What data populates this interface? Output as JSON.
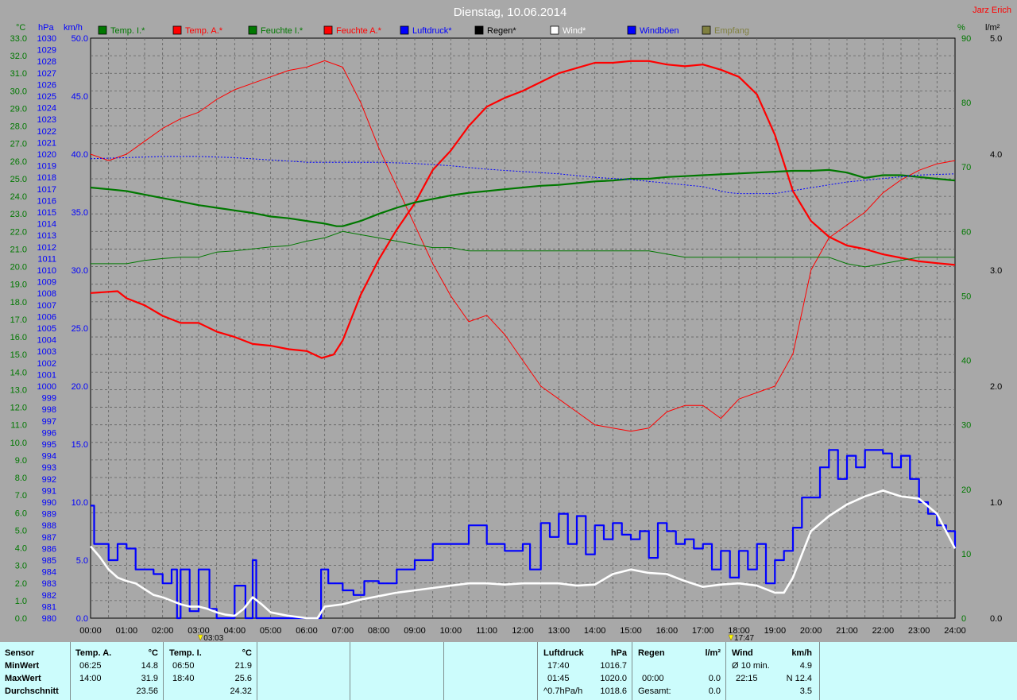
{
  "header": {
    "title": "Dienstag, 10.06.2014",
    "author": "Jarz Erich"
  },
  "axis_units": {
    "temp": "°C",
    "hpa": "hPa",
    "kmh": "km/h",
    "pct": "%",
    "rain": "l/m²"
  },
  "legend": [
    {
      "label": "Temp. I.*",
      "color": "#007800"
    },
    {
      "label": "Temp. A.*",
      "color": "#ff0000"
    },
    {
      "label": "Feuchte I.*",
      "color": "#007800"
    },
    {
      "label": "Feuchte A.*",
      "color": "#ff0000"
    },
    {
      "label": "Luftdruck*",
      "color": "#0000ff"
    },
    {
      "label": "Regen*",
      "color": "#000000"
    },
    {
      "label": "Wind*",
      "color": "#ffffff"
    },
    {
      "label": "Windböen",
      "color": "#0000ff"
    },
    {
      "label": "Empfang",
      "color": "#808040"
    }
  ],
  "chart_data": {
    "type": "line",
    "title": "Dienstag, 10.06.2014",
    "xlim": [
      0,
      24
    ],
    "x_ticks": [
      "00:00",
      "01:00",
      "02:00",
      "03:00",
      "04:00",
      "05:00",
      "06:00",
      "07:00",
      "08:00",
      "09:00",
      "10:00",
      "11:00",
      "12:00",
      "13:00",
      "14:00",
      "15:00",
      "16:00",
      "17:00",
      "18:00",
      "19:00",
      "20:00",
      "21:00",
      "22:00",
      "23:00",
      "24:00"
    ],
    "x_markers": [
      {
        "label": "03:03",
        "x": 3.05
      },
      {
        "label": "17:47",
        "x": 17.78
      }
    ],
    "axes": {
      "temp": {
        "label": "°C",
        "ylim": [
          0,
          33
        ],
        "ticks": [
          "33.0",
          "32.0",
          "31.0",
          "30.0",
          "29.0",
          "28.0",
          "27.0",
          "26.0",
          "25.0",
          "24.0",
          "23.0",
          "22.0",
          "21.0",
          "20.0",
          "19.0",
          "18.0",
          "17.0",
          "16.0",
          "15.0",
          "14.0",
          "13.0",
          "12.0",
          "11.0",
          "10.0",
          "9.0",
          "8.0",
          "7.0",
          "6.0",
          "5.0",
          "4.0",
          "3.0",
          "2.0",
          "1.0",
          "0.0"
        ]
      },
      "pressure": {
        "label": "hPa",
        "ylim": [
          980,
          1030
        ],
        "ticks": [
          "1030",
          "1029",
          "1028",
          "1027",
          "1026",
          "1025",
          "1024",
          "1023",
          "1022",
          "1021",
          "1020",
          "1019",
          "1018",
          "1017",
          "1016",
          "1015",
          "1014",
          "1013",
          "1012",
          "1011",
          "1010",
          "1009",
          "1008",
          "1007",
          "1006",
          "1005",
          "1004",
          "1003",
          "1002",
          "1001",
          "1000",
          "999",
          "998",
          "997",
          "996",
          "995",
          "994",
          "993",
          "992",
          "991",
          "990",
          "989",
          "988",
          "987",
          "986",
          "985",
          "984",
          "983",
          "982",
          "981",
          "980"
        ]
      },
      "wind": {
        "label": "km/h",
        "ylim": [
          0,
          50
        ],
        "ticks": [
          "50.0",
          "45.0",
          "40.0",
          "35.0",
          "30.0",
          "25.0",
          "20.0",
          "15.0",
          "10.0",
          "5.0",
          "0.0"
        ]
      },
      "humidity": {
        "label": "%",
        "ylim": [
          0,
          90
        ],
        "ticks": [
          "90",
          "80",
          "70",
          "60",
          "50",
          "40",
          "30",
          "20",
          "10",
          "0"
        ]
      },
      "rain": {
        "label": "l/m²",
        "ylim": [
          0,
          5
        ],
        "ticks": [
          "5.0",
          "4.0",
          "3.0",
          "2.0",
          "1.0",
          "0.0"
        ]
      }
    },
    "grid": true,
    "series": [
      {
        "name": "Temp. A.*",
        "axis": "temp",
        "color": "#ff0000",
        "width": 2.2,
        "x": [
          0,
          0.75,
          1,
          1.5,
          2,
          2.5,
          3,
          3.5,
          4,
          4.5,
          5,
          5.5,
          6,
          6.42,
          6.75,
          7,
          7.5,
          8,
          8.5,
          9,
          9.5,
          10,
          10.5,
          11,
          11.5,
          12,
          12.5,
          13,
          13.5,
          14,
          14.5,
          15,
          15.5,
          16,
          16.5,
          17,
          17.5,
          18,
          18.5,
          19,
          19.5,
          20,
          20.5,
          21,
          21.5,
          22,
          22.5,
          23,
          23.5,
          24
        ],
        "y": [
          18.5,
          18.6,
          18.2,
          17.8,
          17.2,
          16.8,
          16.8,
          16.3,
          16.0,
          15.6,
          15.5,
          15.3,
          15.2,
          14.8,
          15.0,
          15.8,
          18.4,
          20.4,
          22.1,
          23.6,
          25.5,
          26.6,
          28.0,
          29.1,
          29.6,
          30.0,
          30.5,
          31.0,
          31.3,
          31.6,
          31.6,
          31.7,
          31.7,
          31.5,
          31.4,
          31.5,
          31.2,
          30.8,
          29.8,
          27.5,
          24.3,
          22.6,
          21.7,
          21.2,
          21.0,
          20.7,
          20.5,
          20.3,
          20.2,
          20.1
        ]
      },
      {
        "name": "Feuchte A.*",
        "axis": "humidity",
        "color": "#ff0000",
        "width": 1,
        "x": [
          0,
          0.5,
          1,
          1.5,
          2,
          2.5,
          3,
          3.5,
          4,
          4.5,
          5,
          5.5,
          6,
          6.5,
          7,
          7.5,
          8,
          8.5,
          9,
          9.5,
          10,
          10.5,
          11,
          11.5,
          12,
          12.5,
          13,
          13.5,
          14,
          14.5,
          15,
          15.5,
          16,
          16.5,
          17,
          17.5,
          18,
          18.5,
          19,
          19.5,
          20,
          20.5,
          21,
          21.5,
          22,
          22.5,
          23,
          23.5,
          24
        ],
        "y": [
          72,
          71,
          72,
          74,
          76,
          77.5,
          78.5,
          80.5,
          82,
          83,
          84,
          85,
          85.5,
          86.5,
          85.5,
          80,
          73,
          67,
          61,
          55,
          50,
          46,
          47,
          44,
          40,
          36,
          34,
          32,
          30,
          29.5,
          29,
          29.5,
          32,
          33,
          33,
          31,
          34,
          35,
          36,
          41,
          54,
          59,
          61,
          63,
          66,
          68,
          69.5,
          70.5,
          71
        ]
      },
      {
        "name": "Temp. I.*",
        "axis": "temp",
        "color": "#007800",
        "width": 2.2,
        "x": [
          0,
          0.5,
          1,
          1.5,
          2,
          2.5,
          3,
          3.5,
          4,
          4.5,
          5,
          5.5,
          6,
          6.5,
          6.83,
          7,
          7.5,
          8,
          8.5,
          9,
          9.5,
          10,
          10.5,
          11,
          11.5,
          12,
          12.5,
          13,
          13.5,
          14,
          14.5,
          15,
          15.5,
          16,
          16.5,
          17,
          17.5,
          18,
          18.5,
          19,
          19.5,
          20,
          20.5,
          21,
          21.5,
          22,
          22.5,
          23,
          23.5,
          24
        ],
        "y": [
          24.5,
          24.4,
          24.3,
          24.1,
          23.9,
          23.7,
          23.5,
          23.35,
          23.2,
          23.05,
          22.85,
          22.75,
          22.6,
          22.45,
          22.3,
          22.3,
          22.6,
          23.0,
          23.35,
          23.65,
          23.85,
          24.05,
          24.2,
          24.3,
          24.4,
          24.5,
          24.6,
          24.65,
          24.75,
          24.85,
          24.9,
          25.0,
          25.0,
          25.1,
          25.15,
          25.2,
          25.25,
          25.3,
          25.35,
          25.4,
          25.45,
          25.45,
          25.5,
          25.35,
          25.05,
          25.2,
          25.2,
          25.1,
          25.0,
          24.9
        ]
      },
      {
        "name": "Feuchte I.*",
        "axis": "humidity",
        "color": "#007800",
        "width": 1,
        "x": [
          0,
          1,
          1.5,
          2,
          2.5,
          3,
          3.5,
          4,
          4.5,
          5,
          5.5,
          6,
          6.5,
          7,
          7.5,
          8,
          8.5,
          9,
          9.5,
          10,
          10.5,
          11,
          11.5,
          12,
          12.5,
          13,
          13.5,
          14,
          14.5,
          15,
          15.5,
          16,
          16.5,
          17,
          17.5,
          18,
          18.5,
          19,
          19.5,
          20,
          20.5,
          21,
          21.5,
          22,
          22.5,
          23,
          23.5,
          24
        ],
        "y": [
          55,
          55,
          55.5,
          55.8,
          56,
          56,
          56.8,
          57,
          57.3,
          57.6,
          57.8,
          58.5,
          59,
          60,
          59.5,
          59,
          58.5,
          58,
          57.5,
          57.5,
          57,
          57,
          57,
          57,
          57,
          57,
          57,
          57,
          57,
          57,
          57,
          56.5,
          56,
          56,
          56,
          56,
          56,
          56,
          56,
          56,
          56,
          55,
          54.5,
          55,
          55.5,
          56,
          56,
          56
        ]
      },
      {
        "name": "Luftdruck*",
        "axis": "pressure",
        "color": "#0000ff",
        "width": 1,
        "dashed": true,
        "x": [
          0,
          1,
          2,
          3,
          4,
          5,
          6,
          7,
          8,
          9,
          10,
          11,
          12,
          13,
          14,
          15,
          16,
          17,
          17.67,
          18,
          19,
          20,
          21,
          22,
          23,
          24
        ],
        "y": [
          1019.6,
          1019.7,
          1019.8,
          1019.8,
          1019.7,
          1019.5,
          1019.3,
          1019.3,
          1019.3,
          1019.2,
          1019.0,
          1018.7,
          1018.5,
          1018.3,
          1018.0,
          1017.8,
          1017.5,
          1017.2,
          1016.7,
          1016.6,
          1016.6,
          1017.1,
          1017.6,
          1017.9,
          1018.2,
          1018.3
        ]
      },
      {
        "name": "Windböen",
        "axis": "wind",
        "color": "#0000ff",
        "width": 2.2,
        "step": true,
        "x": [
          0,
          0.1,
          0.5,
          0.75,
          1,
          1.25,
          1.5,
          1.75,
          2,
          2.25,
          2.4,
          2.5,
          2.75,
          3,
          3.3,
          3.5,
          4,
          4.3,
          4.5,
          4.6,
          6.4,
          6.6,
          7,
          7.3,
          7.6,
          8,
          8.5,
          9,
          9.5,
          10,
          10.5,
          11,
          11.5,
          12,
          12.2,
          12.5,
          12.75,
          13,
          13.25,
          13.5,
          13.75,
          14,
          14.25,
          14.5,
          14.75,
          15,
          15.25,
          15.5,
          15.75,
          16,
          16.25,
          16.5,
          16.75,
          17,
          17.25,
          17.5,
          17.75,
          18,
          18.25,
          18.5,
          18.75,
          19,
          19.25,
          19.5,
          19.75,
          20,
          20.25,
          20.5,
          20.75,
          21,
          21.25,
          21.5,
          21.75,
          22,
          22.25,
          22.5,
          22.75,
          23,
          23.25,
          23.5,
          23.75,
          24
        ],
        "y": [
          9.7,
          6.4,
          5.0,
          6.4,
          6.0,
          4.2,
          4.2,
          3.8,
          3.0,
          4.2,
          0.0,
          4.2,
          0.6,
          4.2,
          0.8,
          0.0,
          2.8,
          0.0,
          5.0,
          0.0,
          4.2,
          3.0,
          2.4,
          2.0,
          3.2,
          3.0,
          4.2,
          5.0,
          6.4,
          6.4,
          8.0,
          6.4,
          5.8,
          6.4,
          4.2,
          8.2,
          7.0,
          9.0,
          6.4,
          8.8,
          5.5,
          8.0,
          6.8,
          8.2,
          7.2,
          6.8,
          7.5,
          5.2,
          8.2,
          7.5,
          6.4,
          6.8,
          6.0,
          6.4,
          4.2,
          5.8,
          3.5,
          5.8,
          4.2,
          6.4,
          3.0,
          5.0,
          5.8,
          7.8,
          10.4,
          10.4,
          13.0,
          14.5,
          12.0,
          14.0,
          13.0,
          14.5,
          14.5,
          14.2,
          13.0,
          14.0,
          12.0,
          10.0,
          9.0,
          8.0,
          7.5,
          6.0
        ]
      },
      {
        "name": "Wind*",
        "axis": "wind",
        "color": "#ffffff",
        "width": 2.6,
        "x": [
          0,
          0.25,
          0.5,
          0.75,
          1,
          1.25,
          1.5,
          1.75,
          2,
          2.25,
          2.5,
          2.75,
          3,
          3.25,
          3.5,
          3.75,
          4,
          4.25,
          4.5,
          4.75,
          5,
          5.5,
          6,
          6.3,
          6.5,
          7,
          7.5,
          8,
          8.5,
          9,
          9.5,
          10,
          10.5,
          11,
          11.5,
          12,
          12.5,
          13,
          13.5,
          14,
          14.5,
          15,
          15.5,
          16,
          16.5,
          17,
          17.5,
          18,
          18.5,
          19,
          19.25,
          19.5,
          19.75,
          20,
          20.5,
          21,
          21.5,
          22,
          22.5,
          23,
          23.5,
          24
        ],
        "y": [
          6.2,
          5.3,
          4.2,
          3.5,
          3.2,
          3.0,
          2.5,
          2.0,
          1.8,
          1.5,
          1.2,
          1.0,
          1.0,
          0.8,
          0.5,
          0.3,
          0.2,
          0.8,
          1.8,
          1.2,
          0.5,
          0.2,
          0.0,
          0.0,
          1.0,
          1.2,
          1.6,
          1.9,
          2.2,
          2.4,
          2.6,
          2.8,
          3.0,
          3.0,
          2.9,
          3.0,
          3.0,
          3.0,
          2.8,
          2.9,
          3.8,
          4.2,
          3.9,
          3.8,
          3.2,
          2.7,
          2.9,
          3.0,
          2.8,
          2.2,
          2.2,
          3.5,
          5.5,
          7.5,
          8.8,
          9.8,
          10.5,
          11.0,
          10.5,
          10.3,
          9.0,
          6.0
        ]
      }
    ]
  },
  "stats": {
    "c1": {
      "h1": "Sensor",
      "r1": "MinWert",
      "r2": "MaxWert",
      "r3": "Durchschnitt"
    },
    "c2": {
      "h1": "Temp. A.",
      "h2": "°C",
      "r1a": "06:25",
      "r1b": "14.8",
      "r2a": "14:00",
      "r2b": "31.9",
      "r3b": "23.56"
    },
    "c3": {
      "h1": "Temp. I.",
      "h2": "°C",
      "r1a": "06:50",
      "r1b": "21.9",
      "r2a": "18:40",
      "r2b": "25.6",
      "r3b": "24.32"
    },
    "c4": {
      "h1": "Luftdruck",
      "h2": "hPa",
      "r1a": "17:40",
      "r1b": "1016.7",
      "r2a": "01:45",
      "r2b": "1020.0",
      "r3a": "^0.7hPa/h",
      "r3b": "1018.6"
    },
    "c5": {
      "h1": "Regen",
      "h2": "l/m²",
      "r2a": "00:00",
      "r2b": "0.0",
      "r3a": "Gesamt:",
      "r3b": "0.0"
    },
    "c6": {
      "h1": "Wind",
      "h2": "km/h",
      "r1a": "Ø 10 min.",
      "r1b": "4.9",
      "r2a": "22:15",
      "r2b": "N 12.4",
      "r3b": "3.5"
    }
  }
}
